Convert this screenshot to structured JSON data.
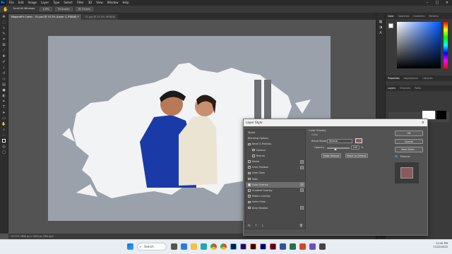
{
  "menubar": {
    "logo": "Ps",
    "items": [
      "File",
      "Edit",
      "Image",
      "Layer",
      "Type",
      "Select",
      "Filter",
      "3D",
      "View",
      "Window",
      "Help"
    ]
  },
  "optionbar": {
    "items": [
      "Scroll All Windows",
      "100%",
      "Fit Screen",
      "Fill Screen"
    ]
  },
  "tabs": [
    {
      "label": "Mogoraff's Comic - 01.psd @ 15.3% (Layer 1, RGB/8) *"
    },
    {
      "label": "01.jpg @ 15.3% (RGB/8)"
    }
  ],
  "status": {
    "text": "15.31%     3600 px x 2400 px (300 ppi)"
  },
  "right_panel": {
    "color_tabs": [
      "Color",
      "Swatches",
      "Gradients",
      "Patterns"
    ],
    "props_tabs": [
      "Properties",
      "Adjustments",
      "Libraries"
    ],
    "layers_tabs": [
      "Layers",
      "Channels",
      "Paths"
    ]
  },
  "dialog": {
    "title": "Layer Style",
    "close": "×",
    "styles_header": "Styles",
    "items": [
      {
        "label": "Blending Options",
        "checkbox": false,
        "sub": false,
        "plus": false,
        "checked": false
      },
      {
        "label": "Bevel & Emboss",
        "checkbox": true,
        "sub": false,
        "plus": false,
        "checked": false
      },
      {
        "label": "Contour",
        "checkbox": true,
        "sub": true,
        "plus": false,
        "checked": false
      },
      {
        "label": "Texture",
        "checkbox": true,
        "sub": true,
        "plus": false,
        "checked": false
      },
      {
        "label": "Stroke",
        "checkbox": true,
        "sub": false,
        "plus": true,
        "checked": false
      },
      {
        "label": "Inner Shadow",
        "checkbox": true,
        "sub": false,
        "plus": true,
        "checked": false
      },
      {
        "label": "Inner Glow",
        "checkbox": true,
        "sub": false,
        "plus": false,
        "checked": false
      },
      {
        "label": "Satin",
        "checkbox": true,
        "sub": false,
        "plus": false,
        "checked": false
      },
      {
        "label": "Color Overlay",
        "checkbox": true,
        "sub": false,
        "plus": true,
        "checked": true,
        "selected": true
      },
      {
        "label": "Gradient Overlay",
        "checkbox": true,
        "sub": false,
        "plus": true,
        "checked": false
      },
      {
        "label": "Pattern Overlay",
        "checkbox": true,
        "sub": false,
        "plus": false,
        "checked": false
      },
      {
        "label": "Outer Glow",
        "checkbox": true,
        "sub": false,
        "plus": false,
        "checked": false
      },
      {
        "label": "Drop Shadow",
        "checkbox": true,
        "sub": false,
        "plus": true,
        "checked": false
      }
    ],
    "section_title": "Color Overlay",
    "group_title": "Color",
    "blend_mode_label": "Blend Mode:",
    "blend_mode_value": "Normal",
    "opacity_label": "Opacity:",
    "opacity_value": "100",
    "opacity_unit": "%",
    "overlay_color": "#8a5a5e",
    "make_default": "Make Default",
    "reset_default": "Reset to Default",
    "ok": "OK",
    "cancel": "Cancel",
    "new_style": "New Style...",
    "preview_label": "Preview",
    "bottom_icons": [
      "fx",
      "↑",
      "↓",
      "trash"
    ]
  },
  "taskbar": {
    "search": "Search",
    "time": "12:42 PM",
    "date": "11/22/2022"
  }
}
